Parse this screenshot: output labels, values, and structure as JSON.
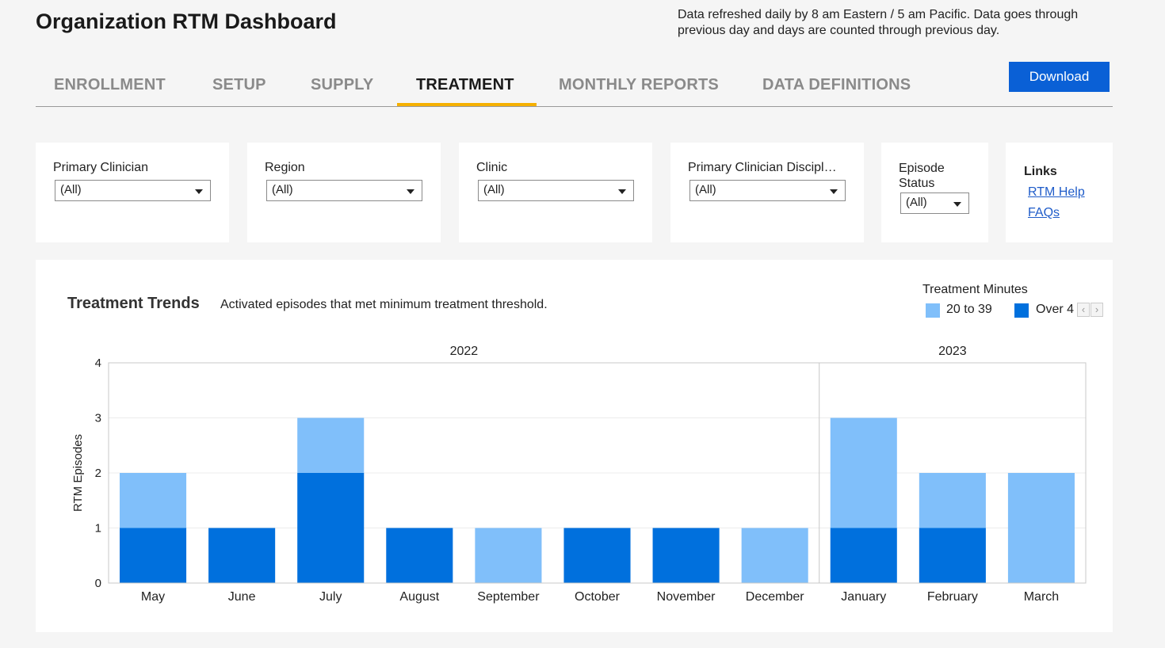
{
  "header": {
    "title": "Organization RTM Dashboard",
    "refresh_note": "Data refreshed daily by 8 am Eastern / 5 am Pacific. Data goes through previous day and days are counted through previous day."
  },
  "tabs": [
    {
      "label": "ENROLLMENT",
      "active": false
    },
    {
      "label": "SETUP",
      "active": false
    },
    {
      "label": "SUPPLY",
      "active": false
    },
    {
      "label": "TREATMENT",
      "active": true
    },
    {
      "label": "MONTHLY REPORTS",
      "active": false
    },
    {
      "label": "DATA DEFINITIONS",
      "active": false
    }
  ],
  "download_label": "Download",
  "filters": [
    {
      "label": "Primary Clinician",
      "value": "(All)"
    },
    {
      "label": "Region",
      "value": "(All)"
    },
    {
      "label": "Clinic",
      "value": "(All)"
    },
    {
      "label": "Primary Clinician Discipl…",
      "value": "(All)"
    },
    {
      "label": "Episode Status",
      "value": "(All)"
    }
  ],
  "links": {
    "title": "Links",
    "items": [
      "RTM Help",
      "FAQs"
    ]
  },
  "colors": {
    "accent": "#0a60d6",
    "tab_underline": "#f5b000",
    "series_20_39": "#80bffa",
    "series_over_40": "#0070dd"
  },
  "chart_data": {
    "type": "bar",
    "stacked": true,
    "title": "Treatment Trends",
    "subtitle": "Activated episodes that met minimum treatment threshold.",
    "legend_title": "Treatment Minutes",
    "legend_placement": "top-right",
    "ylabel": "RTM Episodes",
    "xlabel": "",
    "ylim": [
      0,
      4
    ],
    "yticks": [
      0,
      1,
      2,
      3,
      4
    ],
    "year_groups": [
      {
        "label": "2022",
        "categories": [
          "May",
          "June",
          "July",
          "August",
          "September",
          "October",
          "November",
          "December"
        ]
      },
      {
        "label": "2023",
        "categories": [
          "January",
          "February",
          "March"
        ]
      }
    ],
    "categories": [
      "May",
      "June",
      "July",
      "August",
      "September",
      "October",
      "November",
      "December",
      "January",
      "February",
      "March"
    ],
    "series": [
      {
        "name": "Over 4",
        "color": "#0070dd",
        "values": [
          1,
          1,
          2,
          1,
          0,
          1,
          1,
          0,
          1,
          1,
          0
        ]
      },
      {
        "name": "20 to 39",
        "color": "#80bffa",
        "values": [
          1,
          0,
          1,
          0,
          1,
          0,
          0,
          1,
          2,
          1,
          2
        ]
      }
    ]
  }
}
